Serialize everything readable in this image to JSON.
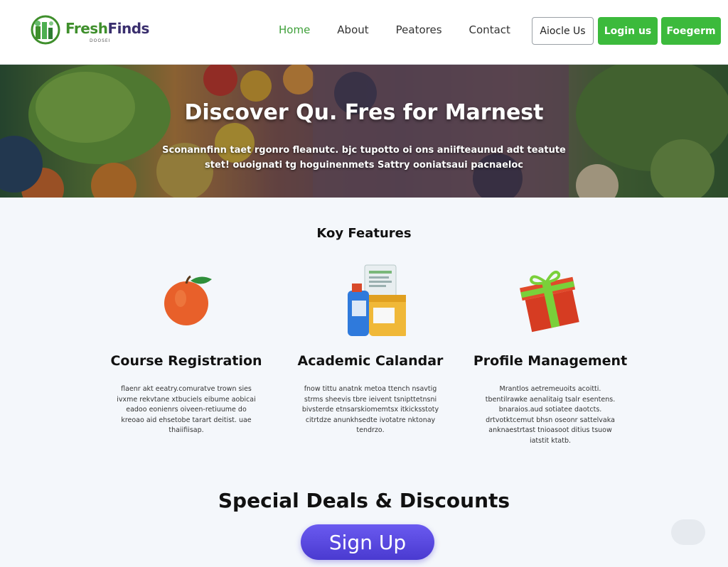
{
  "brand": {
    "name_part1": "Fresh",
    "name_part2": "Finds",
    "tagline": "DOOSEI"
  },
  "nav": {
    "items": [
      {
        "label": "Home",
        "active": true
      },
      {
        "label": "About",
        "active": false
      },
      {
        "label": "Peatores",
        "active": false
      },
      {
        "label": "Contact",
        "active": false
      }
    ]
  },
  "header_buttons": {
    "outline_label": "Aiocle Us",
    "login_label": "Login us",
    "register_label": "Foegerm"
  },
  "hero": {
    "title": "Discover Qu. Fres for Marnest",
    "subtitle": "Sconannfinn taet rgonro fleanutc. bjc tupotto oi ons aniifteaunud adt teatute stet! ouoignati tg hoguinenmets Sattry ooniatsaui pacnaeloc"
  },
  "features": {
    "title": "Koy Features",
    "items": [
      {
        "heading": "Course Registration",
        "icon": "apple-icon",
        "text": "flaenr akt eeatry.comuratve trown sies ivxme rekvtane xtbuciels eibume aobicai eadoo eonienrs oiveen-retiuume do kreoao aid ehsetobe tarart deitist. uae thaiifiisap."
      },
      {
        "heading": "Academic Calandar",
        "icon": "grocery-bottles-icon",
        "text": "fnow tittu anatnk metoa ttench nsavtig strms sheevis tbre ieivent tsnipttetnsni bivsterde etnsarskiomemtsx itkicksstoty citrtdze anunkhsedte ivotatre nktonay tendrzo."
      },
      {
        "heading": "Profile Management",
        "icon": "gift-box-icon",
        "text": "Mrantlos aetremeuoits acoitti. tbentilrawke aenalitaig tsalr esentens. bnaraios.aud sotiatee daotcts. drtvotktcemut bhsn oseonr sattelvaka anknaestrtast tnioasoot ditius tsuow iatstit ktatb."
      }
    ]
  },
  "deals": {
    "title": "Special Deals & Discounts",
    "signup_label": "Sign Up"
  },
  "colors": {
    "accent_green": "#3cba3c",
    "nav_active": "#3fa03a",
    "signup_purple": "#5a4ae0",
    "brand_purple": "#3a2f6e"
  }
}
